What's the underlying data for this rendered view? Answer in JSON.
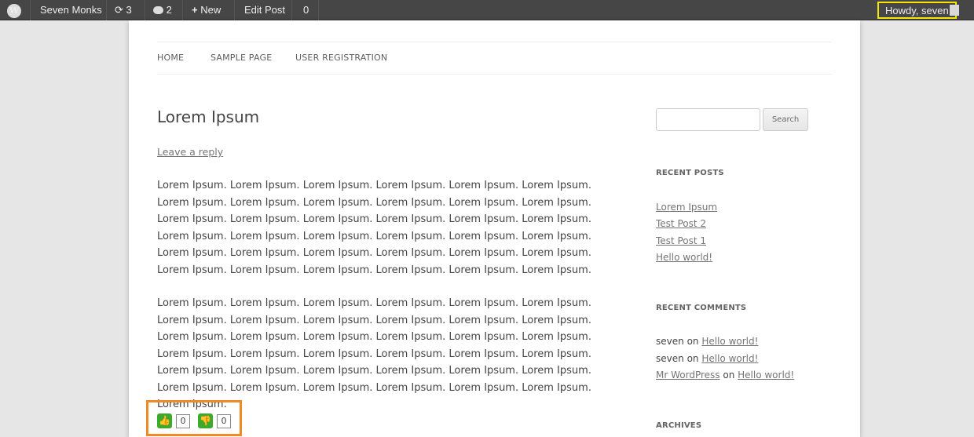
{
  "admin_bar": {
    "logo": "W",
    "site_name": "Seven Monks",
    "updates_count": "3",
    "comments_count": "2",
    "new_label": "New",
    "edit_post_label": "Edit Post",
    "counter": "0",
    "howdy": "Howdy, seven"
  },
  "nav": {
    "items": [
      "HOME",
      "SAMPLE PAGE",
      "USER REGISTRATION"
    ]
  },
  "post": {
    "title": "Lorem Ipsum",
    "leave_reply": "Leave a reply",
    "para1": "Lorem Ipsum. Lorem Ipsum. Lorem Ipsum. Lorem Ipsum. Lorem Ipsum. Lorem Ipsum. Lorem Ipsum. Lorem Ipsum. Lorem Ipsum. Lorem Ipsum. Lorem Ipsum. Lorem Ipsum. Lorem Ipsum. Lorem Ipsum. Lorem Ipsum. Lorem Ipsum. Lorem Ipsum. Lorem Ipsum. Lorem Ipsum. Lorem Ipsum. Lorem Ipsum. Lorem Ipsum. Lorem Ipsum. Lorem Ipsum. Lorem Ipsum. Lorem Ipsum. Lorem Ipsum. Lorem Ipsum. Lorem Ipsum. Lorem Ipsum. Lorem Ipsum. Lorem Ipsum. Lorem Ipsum. Lorem Ipsum. Lorem Ipsum. Lorem Ipsum.",
    "para2": "Lorem Ipsum. Lorem Ipsum. Lorem Ipsum. Lorem Ipsum. Lorem Ipsum. Lorem Ipsum. Lorem Ipsum. Lorem Ipsum. Lorem Ipsum. Lorem Ipsum. Lorem Ipsum. Lorem Ipsum. Lorem Ipsum. Lorem Ipsum. Lorem Ipsum. Lorem Ipsum. Lorem Ipsum. Lorem Ipsum. Lorem Ipsum. Lorem Ipsum. Lorem Ipsum. Lorem Ipsum. Lorem Ipsum. Lorem Ipsum. Lorem Ipsum. Lorem Ipsum. Lorem Ipsum. Lorem Ipsum. Lorem Ipsum. Lorem Ipsum. Lorem Ipsum. Lorem Ipsum. Lorem Ipsum. Lorem Ipsum. Lorem Ipsum. Lorem Ipsum. Lorem Ipsum.",
    "like_count": "0",
    "dislike_count": "0"
  },
  "sidebar": {
    "search_button": "Search",
    "recent_posts_title": "RECENT POSTS",
    "recent_posts": [
      "Lorem Ipsum",
      "Test Post 2",
      "Test Post 1",
      "Hello world!"
    ],
    "recent_comments_title": "RECENT COMMENTS",
    "recent_comments": [
      {
        "author": "seven",
        "on": "on",
        "post": "Hello world!"
      },
      {
        "author": "seven",
        "on": "on",
        "post": "Hello world!"
      },
      {
        "author": "Mr WordPress",
        "on": "on",
        "post": "Hello world!"
      }
    ],
    "archives_title": "ARCHIVES"
  },
  "colors": {
    "admin_bar": "#464646",
    "highlight_yellow": "#f5e60a",
    "highlight_orange": "#f08a24",
    "vote_green": "#3eaa2c"
  }
}
